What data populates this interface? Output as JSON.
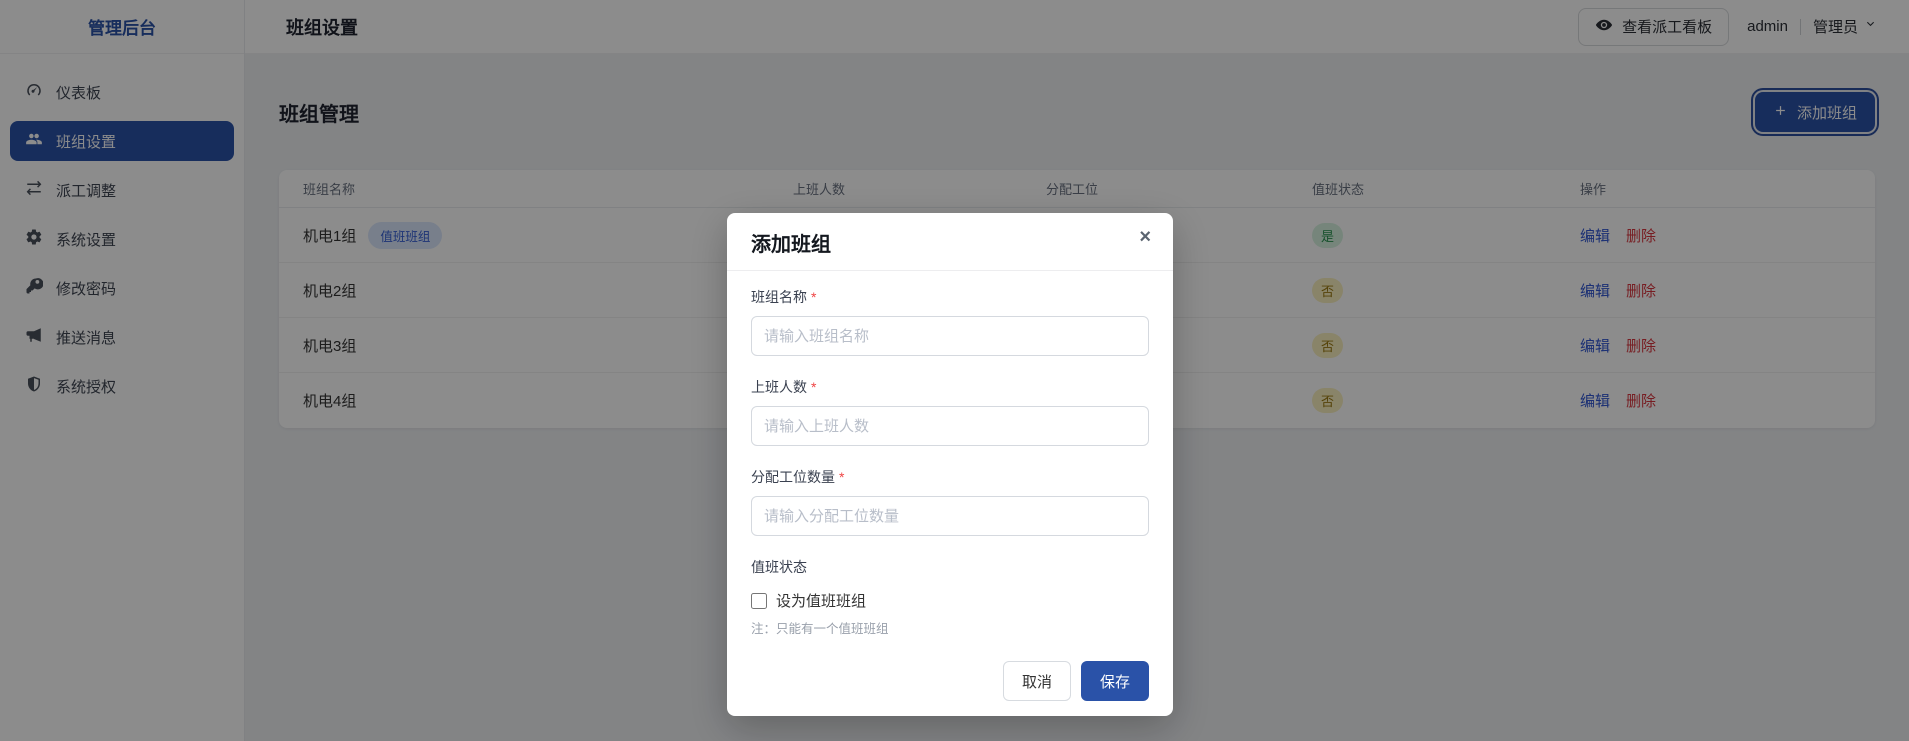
{
  "app": {
    "logo": "管理后台"
  },
  "sidebar": {
    "items": [
      {
        "label": "仪表板",
        "icon": "gauge-icon",
        "active": false
      },
      {
        "label": "班组设置",
        "icon": "users-icon",
        "active": true
      },
      {
        "label": "派工调整",
        "icon": "exchange-icon",
        "active": false
      },
      {
        "label": "系统设置",
        "icon": "gear-icon",
        "active": false
      },
      {
        "label": "修改密码",
        "icon": "key-icon",
        "active": false
      },
      {
        "label": "推送消息",
        "icon": "megaphone-icon",
        "active": false
      },
      {
        "label": "系统授权",
        "icon": "shield-icon",
        "active": false
      }
    ]
  },
  "header": {
    "title": "班组设置",
    "board_button": "查看派工看板",
    "username": "admin",
    "role": "管理员"
  },
  "main": {
    "section_title": "班组管理",
    "add_button": "添加班组",
    "table": {
      "columns": [
        "班组名称",
        "上班人数",
        "分配工位",
        "值班状态",
        "操作"
      ],
      "rows": [
        {
          "name": "机电1组",
          "badge": "值班班组",
          "on_duty_count": "",
          "stations": "",
          "duty_status": "是",
          "duty_color": "green",
          "edit": "编辑",
          "delete": "删除"
        },
        {
          "name": "机电2组",
          "badge": "",
          "on_duty_count": "",
          "stations": "",
          "duty_status": "否",
          "duty_color": "yellow",
          "edit": "编辑",
          "delete": "删除"
        },
        {
          "name": "机电3组",
          "badge": "",
          "on_duty_count": "",
          "stations": "",
          "duty_status": "否",
          "duty_color": "yellow",
          "edit": "编辑",
          "delete": "删除"
        },
        {
          "name": "机电4组",
          "badge": "",
          "on_duty_count": "",
          "stations": "",
          "duty_status": "否",
          "duty_color": "yellow",
          "edit": "编辑",
          "delete": "删除"
        }
      ]
    }
  },
  "modal": {
    "title": "添加班组",
    "close": "×",
    "required_mark": "*",
    "fields": [
      {
        "label": "班组名称",
        "required": true,
        "placeholder": "请输入班组名称",
        "value": ""
      },
      {
        "label": "上班人数",
        "required": true,
        "placeholder": "请输入上班人数",
        "value": ""
      },
      {
        "label": "分配工位数量",
        "required": true,
        "placeholder": "请输入分配工位数量",
        "value": ""
      }
    ],
    "duty": {
      "label": "值班状态",
      "checkbox_label": "设为值班班组",
      "note": "注：只能有一个值班班组",
      "checked": false
    },
    "cancel_label": "取消",
    "save_label": "保存"
  },
  "colors": {
    "primary": "#2a52a8",
    "link_blue": "#3056d3",
    "delete_red": "#d9363e",
    "badge_bg": "#dbe7fd",
    "badge_text": "#3560d6",
    "status_yes_bg": "#d8f3e1",
    "status_yes_text": "#28934f",
    "status_no_bg": "#faf0bf",
    "status_no_text": "#9c7a12",
    "overlay": "rgba(0,0,0,0.45)"
  }
}
